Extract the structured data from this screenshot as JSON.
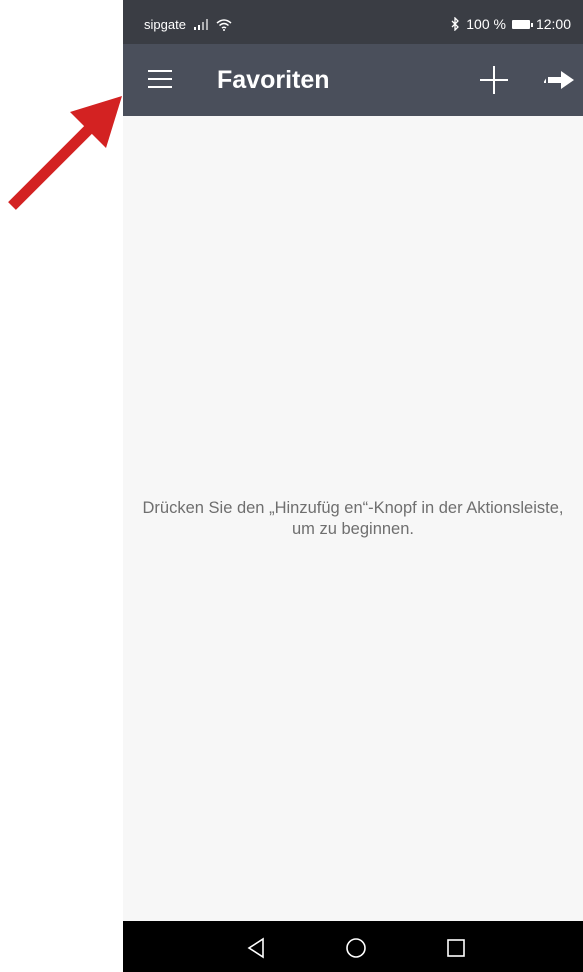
{
  "status_bar": {
    "carrier": "sipgate",
    "battery": "100 %",
    "time": "12:00",
    "icons": [
      "signal-icon",
      "wifi-icon",
      "bluetooth-icon",
      "battery-icon"
    ]
  },
  "app_bar": {
    "title": "Favoriten",
    "icons": [
      "menu-icon",
      "add-icon",
      "forward-icon"
    ]
  },
  "content": {
    "empty_line1": "Drücken Sie den „Hinzufüg en“-Knopf in der Aktionsleiste,",
    "empty_line2": "um zu beginnen."
  },
  "nav_bar": {
    "icons": [
      "back-icon",
      "home-icon",
      "recents-icon"
    ]
  },
  "colors": {
    "status_bar": "#3a3d44",
    "app_bar": "#4a4f5b",
    "background": "#f7f7f7",
    "annotation_arrow": "#d32222"
  }
}
